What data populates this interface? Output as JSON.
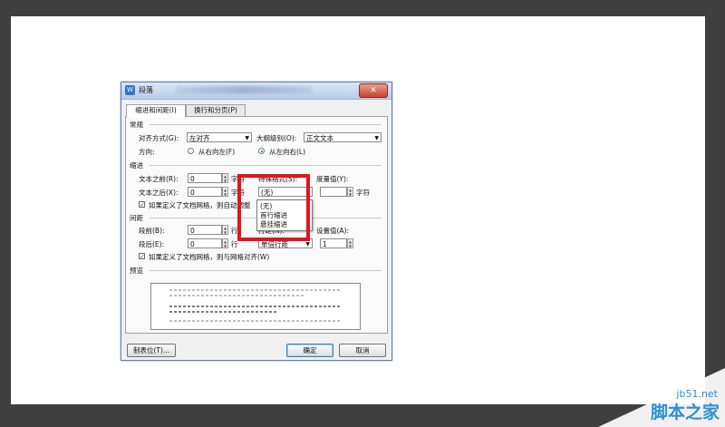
{
  "dialog": {
    "title": "段落",
    "close_label": "✕",
    "tabs": [
      {
        "label": "缩进和间距(I)",
        "active": true
      },
      {
        "label": "换行和分页(P)",
        "active": false
      }
    ],
    "general": {
      "section_label": "常规",
      "alignment_label": "对齐方式(G):",
      "alignment_value": "左对齐",
      "outline_label": "大纲级别(O):",
      "outline_value": "正文文本",
      "direction_label": "方向:",
      "rtl_label": "从右向左(F)",
      "ltr_label": "从左向右(L)",
      "ltr_selected": true
    },
    "indent": {
      "section_label": "缩进",
      "before_label": "文本之前(R):",
      "before_value": "0",
      "before_unit": "字符",
      "special_label": "特殊格式(S):",
      "value_label": "度量值(Y):",
      "after_label": "文本之后(X):",
      "after_value": "0",
      "after_unit": "字符",
      "special_value": "(无)",
      "value_unit": "字符",
      "grid_check_label": "如果定义了文档网格，则自动调整",
      "grid_checked": true
    },
    "special_options": [
      "(无)",
      "首行缩进",
      "悬挂缩进"
    ],
    "spacing": {
      "section_label": "间距",
      "before_label": "段前(B):",
      "before_value": "0",
      "before_unit": "行",
      "line_label": "行距(N):",
      "at_label": "设置值(A):",
      "after_label": "段后(E):",
      "after_value": "0",
      "after_unit": "行",
      "line_value": "单倍行距",
      "at_value": "1",
      "grid_check_label": "如果定义了文档网格，则与网格对齐(W)",
      "grid_checked": true
    },
    "preview_label": "预览",
    "tabs_button_label": "制表位(T)...",
    "ok_label": "确定",
    "cancel_label": "取消"
  },
  "colors": {
    "highlight": "#e3141f",
    "watermark": "#2d8fd4"
  },
  "watermark": {
    "domain": "jb51.net",
    "name": "脚本之家"
  }
}
